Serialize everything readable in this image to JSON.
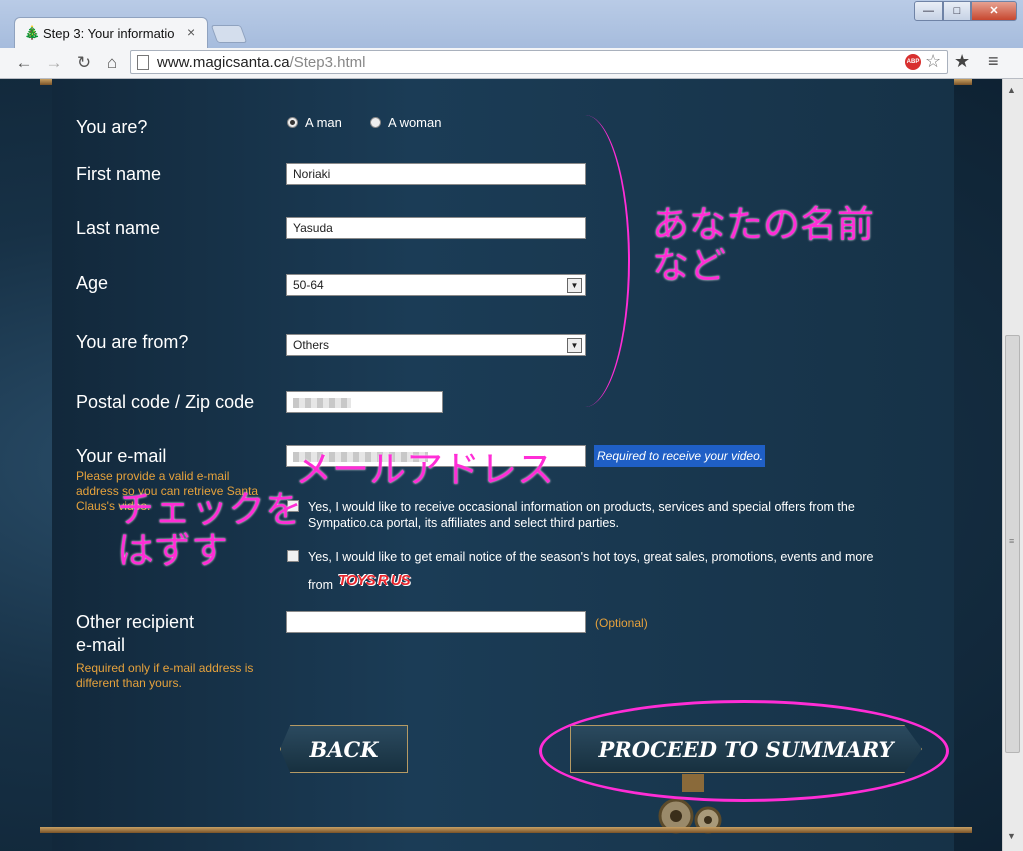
{
  "browser": {
    "tab_title": "Step 3: Your informatio",
    "tab_close": "×",
    "url_host": "www.magicsanta.ca",
    "url_path": "/Step3.html",
    "win_min": "—",
    "win_max": "□",
    "win_close": "✕",
    "abp_label": "ABP"
  },
  "form": {
    "gender": {
      "label": "You are?",
      "options": [
        "A man",
        "A woman"
      ],
      "selected": "A man"
    },
    "first_name": {
      "label": "First name",
      "value": "Noriaki"
    },
    "last_name": {
      "label": "Last name",
      "value": "Yasuda"
    },
    "age": {
      "label": "Age",
      "value": "50-64"
    },
    "from": {
      "label": "You are from?",
      "value": "Others"
    },
    "postal": {
      "label": "Postal code / Zip code"
    },
    "email": {
      "label": "Your e-mail",
      "help": "Please provide a valid e-mail address so you can retrieve Santa Claus's video.",
      "badge": "Required to receive your video."
    },
    "optin_sympatico": "Yes, I would like to receive occasional information on products, services and special offers from the Sympatico.ca portal, its affiliates and select third parties.",
    "optin_toysrus": "Yes, I would like to get email notice of the season's hot toys, great sales, promotions, events and more",
    "optin_toysrus_from": "from",
    "toysrus_logo": "TOYS R US",
    "other_email": {
      "label_line1": "Other recipient",
      "label_line2": "e-mail",
      "help": "Required only if e-mail address is different than yours.",
      "optional": "(Optional)"
    }
  },
  "buttons": {
    "back": "BACK",
    "proceed": "PROCEED TO SUMMARY"
  },
  "annotations": {
    "name_line1": "あなたの名前",
    "name_line2": "など",
    "email": "メールアドレス",
    "uncheck_line1": "チェックを",
    "uncheck_line2": "はずす"
  },
  "colors": {
    "annotation": "#ff2dd6",
    "help_text": "#e6a23c",
    "badge": "#1f5fc6"
  }
}
